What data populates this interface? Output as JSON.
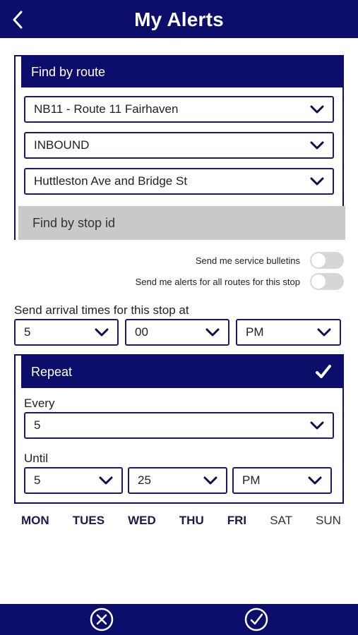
{
  "header": {
    "title": "My Alerts"
  },
  "find_by_route": {
    "label": "Find by route",
    "route": "NB11 - Route 11 Fairhaven",
    "direction": "INBOUND",
    "stop": "Huttleston Ave and Bridge St"
  },
  "find_by_stop_id": {
    "label": "Find by stop id"
  },
  "toggles": {
    "service_bulletins": {
      "label": "Send me service bulletins",
      "on": false
    },
    "all_routes": {
      "label": "Send me alerts for all routes for this stop",
      "on": false
    }
  },
  "arrival": {
    "label": "Send arrival times for this stop at",
    "hour": "5",
    "minute": "00",
    "ampm": "PM"
  },
  "repeat": {
    "label": "Repeat",
    "checked": true,
    "every_label": "Every",
    "every_value": "5",
    "until_label": "Until",
    "until_hour": "5",
    "until_minute": "25",
    "until_ampm": "PM"
  },
  "days": [
    {
      "label": "MON",
      "selected": true
    },
    {
      "label": "TUES",
      "selected": true
    },
    {
      "label": "WED",
      "selected": true
    },
    {
      "label": "THU",
      "selected": true
    },
    {
      "label": "FRI",
      "selected": true
    },
    {
      "label": "SAT",
      "selected": false
    },
    {
      "label": "SUN",
      "selected": false
    }
  ],
  "colors": {
    "brand": "#0d0d6b",
    "inactive_tab": "#c9c9c9",
    "toggle_off": "#d6d6d6"
  },
  "icons": {
    "back": "chevron-left-icon",
    "cancel": "circle-x-icon",
    "confirm": "circle-check-icon"
  }
}
